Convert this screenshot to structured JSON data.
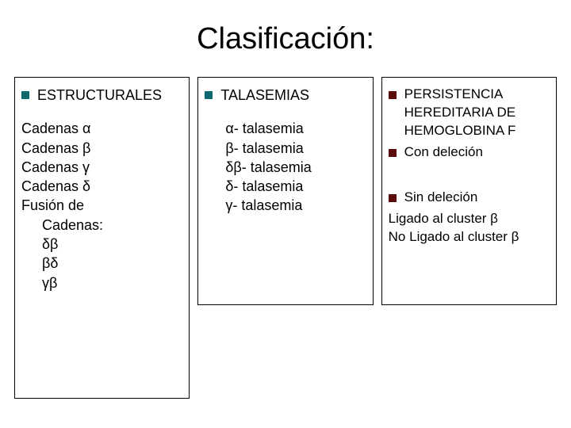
{
  "title": "Clasificación:",
  "col1": {
    "heading": "ESTRUCTURALES",
    "lines": [
      "Cadenas α",
      "Cadenas β",
      "Cadenas γ",
      "Cadenas δ"
    ],
    "fusion_label": "Fusión de",
    "fusion_sub": "Cadenas:",
    "fusion_items": [
      "δβ",
      "βδ",
      "γβ"
    ]
  },
  "col2": {
    "heading": "TALASEMIAS",
    "lines": [
      "α- talasemia",
      "β- talasemia",
      "δβ- talasemia",
      "δ- talasemia",
      "γ- talasemia"
    ]
  },
  "col3": {
    "heading": "PERSISTENCIA HEREDITARIA DE HEMOGLOBINA F",
    "con": "Con deleción",
    "sin": "Sin deleción",
    "l1": "Ligado al cluster β",
    "l2": "No Ligado al cluster β"
  }
}
